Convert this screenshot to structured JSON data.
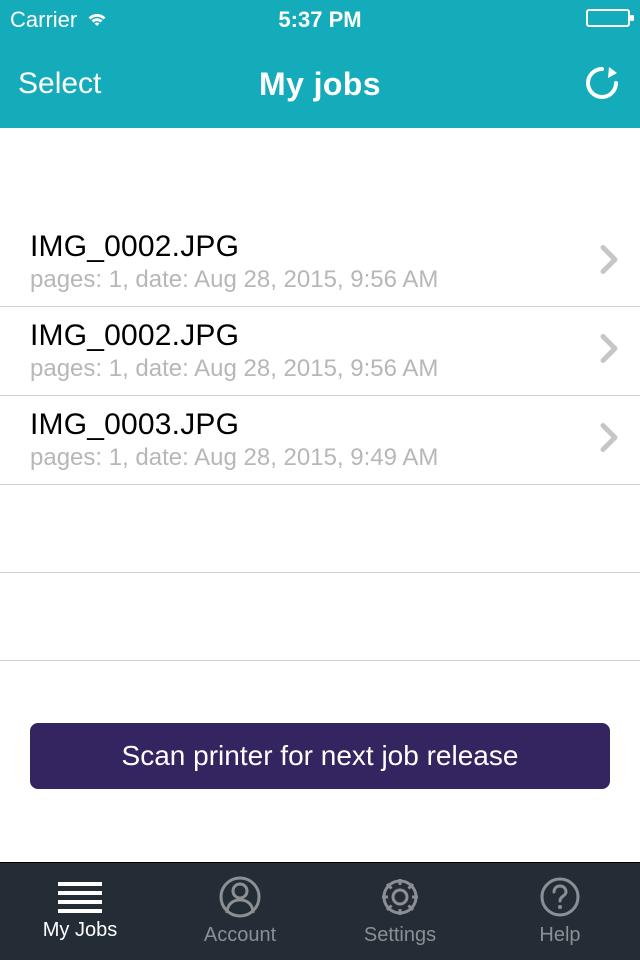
{
  "status": {
    "carrier": "Carrier",
    "time": "5:37 PM"
  },
  "nav": {
    "select_label": "Select",
    "title": "My jobs"
  },
  "jobs": [
    {
      "filename": "IMG_0002.JPG",
      "meta": "pages: 1, date: Aug 28, 2015, 9:56 AM"
    },
    {
      "filename": "IMG_0002.JPG",
      "meta": "pages: 1, date: Aug 28, 2015, 9:56 AM"
    },
    {
      "filename": "IMG_0003.JPG",
      "meta": "pages: 1, date: Aug 28, 2015, 9:49 AM"
    }
  ],
  "scan_button_label": "Scan printer for next job release",
  "tabs": [
    {
      "label": "My Jobs"
    },
    {
      "label": "Account"
    },
    {
      "label": "Settings"
    },
    {
      "label": "Help"
    }
  ]
}
